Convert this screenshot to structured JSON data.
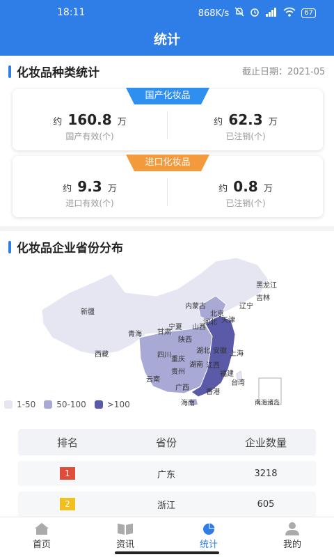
{
  "status_bar": {
    "time": "18:11",
    "network_speed": "868K/s",
    "battery": "67"
  },
  "header": {
    "title": "统计"
  },
  "category_stats": {
    "title": "化妆品种类统计",
    "date_label": "截止日期：2021-05",
    "domestic": {
      "tag": "国产化妆品",
      "valid": {
        "prefix": "约",
        "value": "160.8",
        "unit": "万",
        "label": "国产有效(个)"
      },
      "cancelled": {
        "prefix": "约",
        "value": "62.3",
        "unit": "万",
        "label": "已注销(个)"
      }
    },
    "imported": {
      "tag": "进口化妆品",
      "valid": {
        "prefix": "约",
        "value": "9.3",
        "unit": "万",
        "label": "进口有效(个)"
      },
      "cancelled": {
        "prefix": "约",
        "value": "0.8",
        "unit": "万",
        "label": "已注销(个)"
      }
    }
  },
  "province_distribution": {
    "title": "化妆品企业省份分布",
    "map_labels": {
      "heilongjiang": "黑龙江",
      "jilin": "吉林",
      "liaoning": "辽宁",
      "neimenggu": "内蒙古",
      "beijing": "北京",
      "tianjin": "天津",
      "hebei": "河北",
      "shanxi": "山西",
      "xinjiang": "新疆",
      "qinghai": "青海",
      "gansu": "甘肃",
      "ningxia": "宁夏",
      "shaanxi": "陕西",
      "xizang": "西藏",
      "sichuan": "四川",
      "chongqing": "重庆",
      "hubei": "湖北",
      "anhui": "安徽",
      "shanghai": "上海",
      "hunan": "湖南",
      "jiangxi": "江西",
      "guizhou": "贵州",
      "yunnan": "云南",
      "guangxi": "广西",
      "fujian": "福建",
      "xianggang": "香港",
      "taiwan": "台湾",
      "hainan": "海南",
      "nanhai": "南海诸岛"
    },
    "legend": [
      {
        "label": "1-50",
        "color": "#e6e6f3"
      },
      {
        "label": "50-100",
        "color": "#a9a9d6"
      },
      {
        "label": ">100",
        "color": "#5a5aa8"
      }
    ],
    "table": {
      "headers": [
        "排名",
        "省份",
        "企业数量"
      ],
      "rows": [
        {
          "rank": "1",
          "province": "广东",
          "count": "3218",
          "rank_color": "#e04b3a"
        },
        {
          "rank": "2",
          "province": "浙江",
          "count": "605",
          "rank_color": "#f2c01e"
        }
      ]
    }
  },
  "tabs": [
    {
      "label": "首页",
      "icon": "home-icon"
    },
    {
      "label": "资讯",
      "icon": "book-icon"
    },
    {
      "label": "统计",
      "icon": "pie-chart-icon",
      "active": true
    },
    {
      "label": "我的",
      "icon": "user-icon"
    }
  ],
  "colors": {
    "primary": "#2f7de6",
    "domestic_tag": "#2f8ff0",
    "imported_tag": "#f29a3c"
  }
}
